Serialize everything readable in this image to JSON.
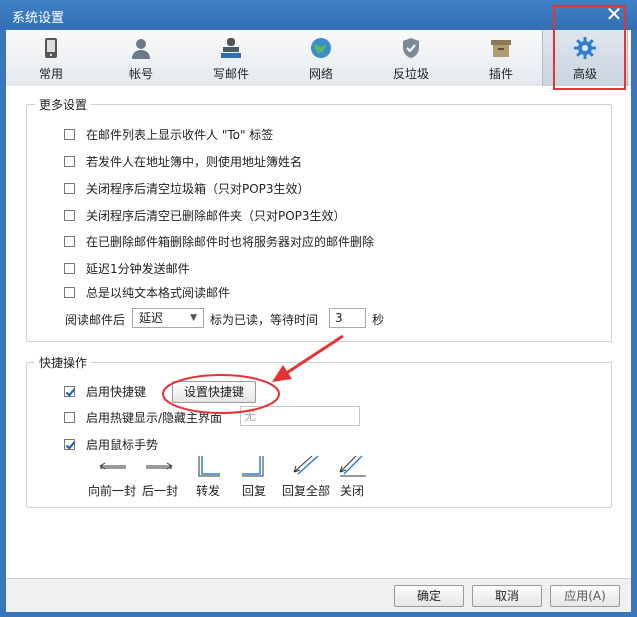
{
  "window": {
    "title": "系统设置"
  },
  "tabs": [
    {
      "label": "常用",
      "icon": "phone-icon"
    },
    {
      "label": "帐号",
      "icon": "user-icon"
    },
    {
      "label": "写邮件",
      "icon": "stamp-icon"
    },
    {
      "label": "网络",
      "icon": "globe-icon"
    },
    {
      "label": "反垃圾",
      "icon": "shield-icon"
    },
    {
      "label": "插件",
      "icon": "archive-icon"
    },
    {
      "label": "高级",
      "icon": "gear-icon",
      "active": true
    }
  ],
  "more": {
    "legend": "更多设置",
    "options": [
      {
        "label": "在邮件列表上显示收件人 \"To\" 标签",
        "checked": false
      },
      {
        "label": "若发件人在地址簿中，则使用地址簿姓名",
        "checked": false
      },
      {
        "label": "关闭程序后清空垃圾箱（只对POP3生效）",
        "checked": false
      },
      {
        "label": "关闭程序后清空已删除邮件夹（只对POP3生效）",
        "checked": false
      },
      {
        "label": "在已删除邮件箱删除邮件时也将服务器对应的邮件删除",
        "checked": false
      },
      {
        "label": "延迟1分钟发送邮件",
        "checked": false
      },
      {
        "label": "总是以纯文本格式阅读邮件",
        "checked": false
      }
    ],
    "read_prefix": "阅读邮件后",
    "read_select": "延迟",
    "read_middle": "标为已读，等待时间",
    "wait_value": "3",
    "wait_unit": "秒"
  },
  "shortcut": {
    "legend": "快捷操作",
    "enable_shortcut": {
      "label": "启用快捷键",
      "checked": true
    },
    "set_button": "设置快捷键",
    "hotkey": {
      "label": "启用热键显示/隐藏主界面",
      "checked": false,
      "value": "无"
    },
    "mouse_gesture": {
      "label": "启用鼠标手势",
      "checked": true
    },
    "gestures": [
      "向前一封",
      "后一封",
      "转发",
      "回复",
      "回复全部",
      "关闭"
    ]
  },
  "footer": {
    "ok": "确定",
    "cancel": "取消",
    "apply": "应用(A)"
  },
  "colors": {
    "title_bar": "#3a76b8",
    "highlight": "#e53333",
    "checkbox_check": "#1a5ea6"
  }
}
